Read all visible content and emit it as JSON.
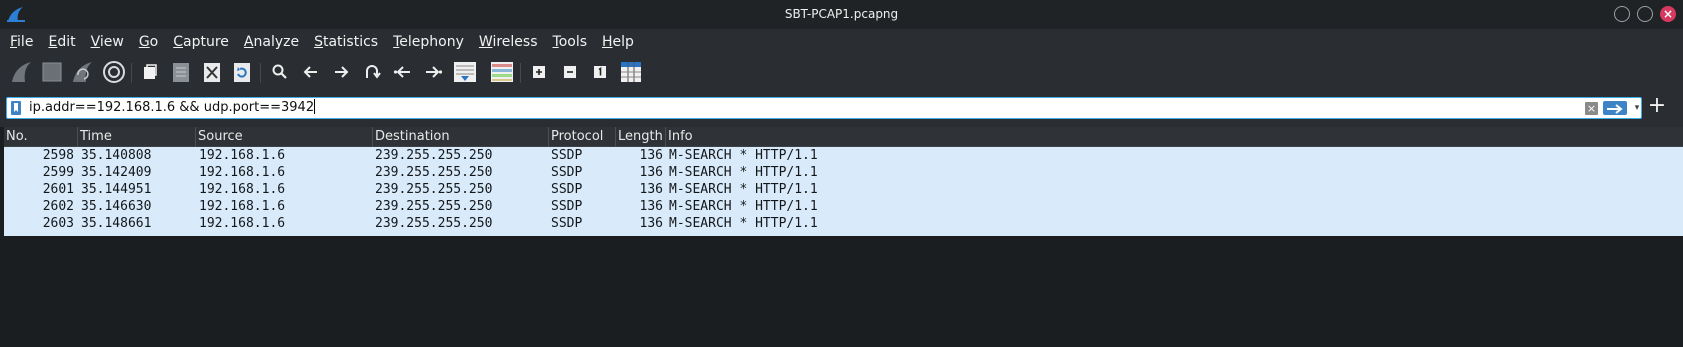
{
  "window": {
    "title": "SBT-PCAP1.pcapng",
    "accent": "#3daee9",
    "close_glyph": "×"
  },
  "menu": [
    {
      "u": "F",
      "rest": "ile"
    },
    {
      "u": "E",
      "rest": "dit"
    },
    {
      "u": "V",
      "rest": "iew"
    },
    {
      "u": "G",
      "rest": "o"
    },
    {
      "u": "C",
      "rest": "apture"
    },
    {
      "u": "A",
      "rest": "nalyze"
    },
    {
      "u": "S",
      "rest": "tatistics"
    },
    {
      "u": "T",
      "rest": "elephony"
    },
    {
      "u": "W",
      "rest": "ireless"
    },
    {
      "u": "T",
      "rest": "ools"
    },
    {
      "u": "H",
      "rest": "elp"
    }
  ],
  "toolbar": {
    "icons": [
      "start-capture-icon",
      "stop-capture-icon",
      "restart-capture-icon",
      "capture-options-icon",
      "open-file-icon",
      "save-file-icon",
      "close-file-icon",
      "reload-file-icon",
      "find-packet-icon",
      "go-back-icon",
      "go-forward-icon",
      "go-to-packet-icon",
      "go-first-icon",
      "go-last-icon",
      "auto-scroll-icon",
      "colorize-icon",
      "zoom-in-icon",
      "zoom-out-icon",
      "normal-size-icon",
      "resize-columns-icon"
    ]
  },
  "filter": {
    "value": "ip.addr==192.168.1.6 && udp.port==3942",
    "clear_glyph": "×",
    "dropdown_glyph": "▾",
    "add_glyph": "+"
  },
  "columns": [
    "No.",
    "Time",
    "Source",
    "Destination",
    "Protocol",
    "Length",
    "Info"
  ],
  "packets": [
    {
      "no": "2598",
      "time": "35.140808",
      "source": "192.168.1.6",
      "destination": "239.255.255.250",
      "protocol": "SSDP",
      "length": "136",
      "info": "M-SEARCH * HTTP/1.1"
    },
    {
      "no": "2599",
      "time": "35.142409",
      "source": "192.168.1.6",
      "destination": "239.255.255.250",
      "protocol": "SSDP",
      "length": "136",
      "info": "M-SEARCH * HTTP/1.1"
    },
    {
      "no": "2601",
      "time": "35.144951",
      "source": "192.168.1.6",
      "destination": "239.255.255.250",
      "protocol": "SSDP",
      "length": "136",
      "info": "M-SEARCH * HTTP/1.1"
    },
    {
      "no": "2602",
      "time": "35.146630",
      "source": "192.168.1.6",
      "destination": "239.255.255.250",
      "protocol": "SSDP",
      "length": "136",
      "info": "M-SEARCH * HTTP/1.1"
    },
    {
      "no": "2603",
      "time": "35.148661",
      "source": "192.168.1.6",
      "destination": "239.255.255.250",
      "protocol": "SSDP",
      "length": "136",
      "info": "M-SEARCH * HTTP/1.1"
    }
  ]
}
